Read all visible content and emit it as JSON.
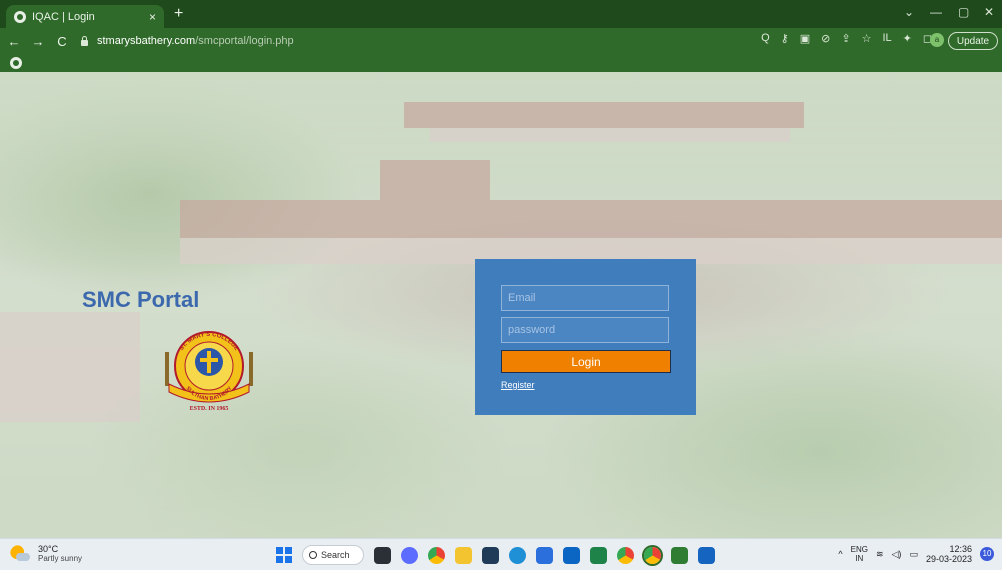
{
  "browser": {
    "tab_title": "IQAC | Login",
    "tab_close": "×",
    "new_tab": "+",
    "url_host": "stmarysbathery.com",
    "url_path": "/smcportal/login.php",
    "update_label": "Update",
    "profile_initial": "a",
    "window_controls": {
      "chevron": "⌄",
      "minimize": "—",
      "restore": "▢",
      "close": "✕"
    },
    "nav": {
      "back": "←",
      "forward": "→",
      "reload": "C"
    },
    "toolbar_icons": [
      "Q",
      "⚷",
      "▣",
      "⊘",
      "⇪",
      "☆",
      "IL",
      "✦",
      "◻"
    ]
  },
  "page": {
    "brand_title": "SMC Portal",
    "logo_text": {
      "arc_top": "ST. MARY'S COLLEGE",
      "arc_bottom": "SULTHAN BATHERY",
      "estd": "ESTD. IN 1965"
    },
    "login": {
      "email_placeholder": "Email",
      "password_placeholder": "password",
      "login_button": "Login",
      "register_link": "Register"
    }
  },
  "taskbar": {
    "weather_temp": "30°C",
    "weather_condition": "Partly sunny",
    "search_label": "Search",
    "lang_top": "ENG",
    "lang_bottom": "IN",
    "time": "12:36",
    "date": "29-03-2023",
    "notification_count": "10",
    "tray_symbols": {
      "chevron": "^",
      "wifi": "≋",
      "volume": "◁)",
      "battery": "▭"
    }
  },
  "colors": {
    "tab_bar": "#1f4a1b",
    "toolbar": "#2f6a2a",
    "brand_blue": "#3c69ad",
    "card_blue": "#3f7dbd",
    "login_orange": "#f08000"
  }
}
